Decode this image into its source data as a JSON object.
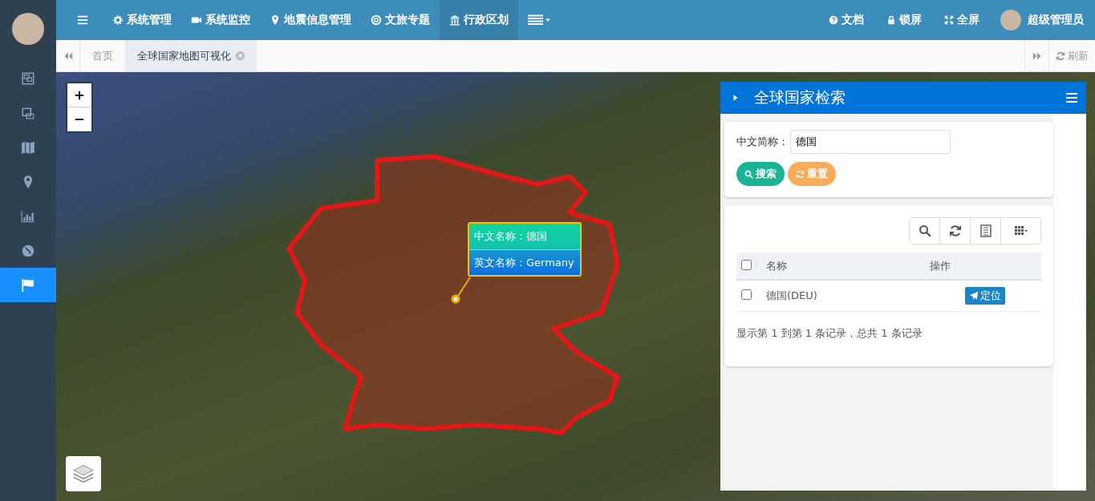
{
  "sidebar": {
    "items": [
      {
        "selected": false
      },
      {
        "selected": false
      },
      {
        "selected": false
      },
      {
        "selected": false
      },
      {
        "selected": false
      },
      {
        "selected": false
      },
      {
        "selected": true
      }
    ]
  },
  "topnav": {
    "items": [
      {
        "label": "系统管理",
        "selected": false
      },
      {
        "label": "系统监控",
        "selected": false
      },
      {
        "label": "地震信息管理",
        "selected": false
      },
      {
        "label": "文旅专题",
        "selected": false
      },
      {
        "label": "行政区划",
        "selected": true
      }
    ],
    "right": [
      {
        "label": "文档"
      },
      {
        "label": "锁屏"
      },
      {
        "label": "全屏"
      }
    ],
    "user": "超级管理员"
  },
  "tabs": [
    {
      "label": "首页",
      "selected": false,
      "closable": false
    },
    {
      "label": "全球国家地图可视化",
      "selected": true,
      "closable": true
    }
  ],
  "refresh": "刷新",
  "map": {
    "popup": [
      {
        "label": "中文名称：德国"
      },
      {
        "label": "英文名称：Germany"
      }
    ]
  },
  "panel": {
    "title": "全球国家检索",
    "field_label": "中文简称：",
    "field_value": "德国",
    "search": "搜索",
    "reset": "重置",
    "columns": [
      "名称",
      "操作"
    ],
    "rows": [
      {
        "name": "德国(DEU)",
        "action": "定位",
        "checked": false
      }
    ],
    "header_checked": false,
    "footer": "显示第 1 到第 1 条记录，总共 1 条记录"
  }
}
